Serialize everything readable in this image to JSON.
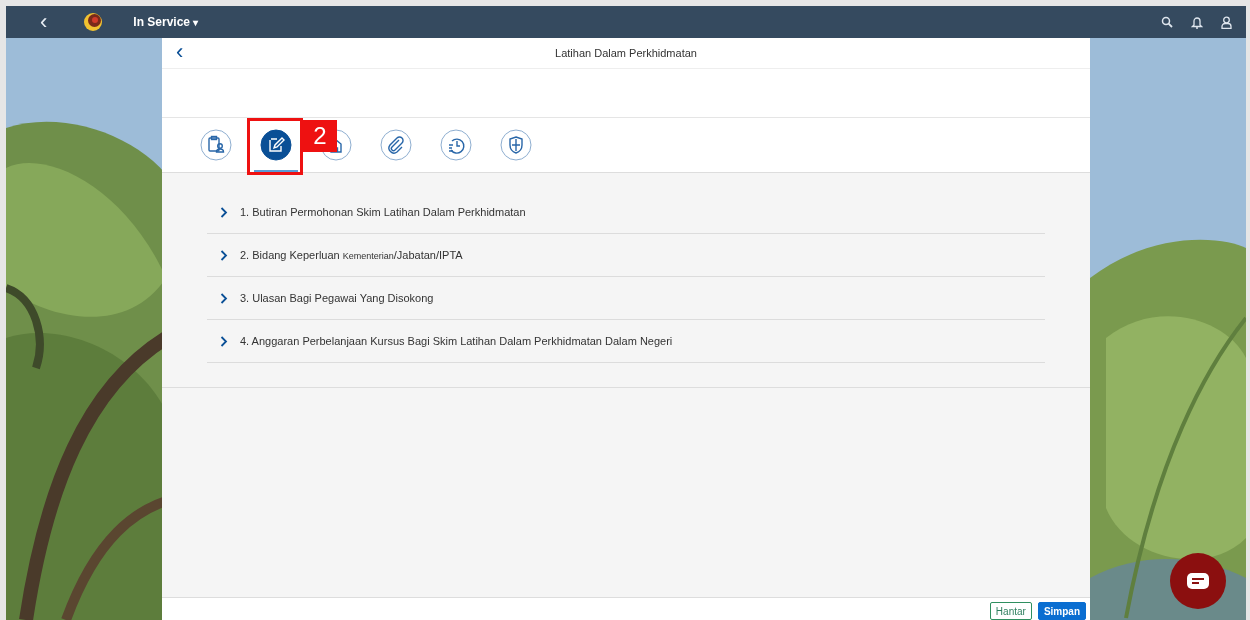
{
  "top_bar": {
    "back": "‹",
    "app_title": "In Service",
    "caret": "▾"
  },
  "page": {
    "back": "‹",
    "title": "Latihan Dalam Perkhidmatan"
  },
  "icon_tabs": [
    {
      "kind": "clipboard",
      "selected": false
    },
    {
      "kind": "edit",
      "selected": true
    },
    {
      "kind": "building",
      "selected": false
    },
    {
      "kind": "attachment",
      "selected": false
    },
    {
      "kind": "history",
      "selected": false
    },
    {
      "kind": "shield",
      "selected": false
    }
  ],
  "annotation": {
    "label": "2"
  },
  "sections": [
    {
      "expanded": false,
      "parts": [
        {
          "text": "1. Butiran Permohonan Skim Latihan Dalam Perkhidmatan",
          "small": false
        }
      ]
    },
    {
      "expanded": false,
      "parts": [
        {
          "text": "2. Bidang Keperluan ",
          "small": false
        },
        {
          "text": "Kementerian",
          "small": true
        },
        {
          "text": "/Jabatan/IPTA",
          "small": false
        }
      ]
    },
    {
      "expanded": false,
      "parts": [
        {
          "text": "3. Ulasan Bagi Pegawai Yang Disokong",
          "small": false
        }
      ]
    },
    {
      "expanded": false,
      "parts": [
        {
          "text": "4. Anggaran Perbelanjaan Kursus Bagi Skim Latihan Dalam Perkhidmatan Dalam Negeri",
          "small": false
        }
      ]
    }
  ],
  "footer": {
    "buttons": [
      {
        "label": "Hantar",
        "kind": "secondary"
      },
      {
        "label": "Simpan",
        "kind": "primary"
      }
    ]
  }
}
